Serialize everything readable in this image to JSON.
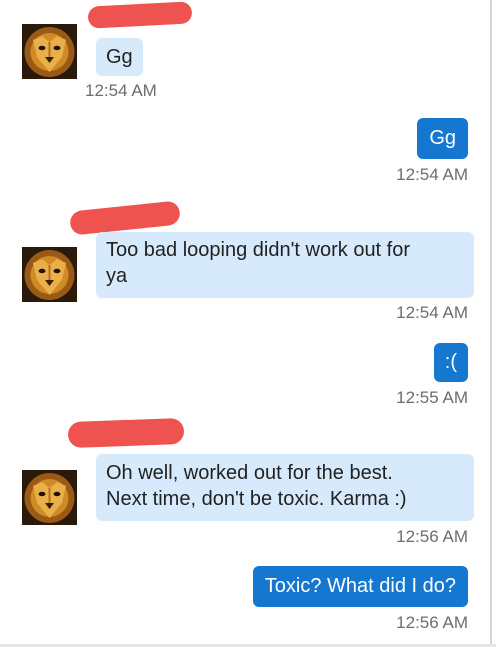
{
  "messages": [
    {
      "id": "m1",
      "direction": "incoming",
      "text": "Gg",
      "time": "12:54 AM",
      "sender_redacted": true
    },
    {
      "id": "m2",
      "direction": "outgoing",
      "text": "Gg",
      "time": "12:54 AM"
    },
    {
      "id": "m3",
      "direction": "incoming",
      "text": "Too bad looping didn't work out for\nya",
      "time": "12:54 AM",
      "sender_redacted": true
    },
    {
      "id": "m4",
      "direction": "outgoing",
      "text": ":(",
      "time": "12:55 AM"
    },
    {
      "id": "m5",
      "direction": "incoming",
      "text": "Oh well, worked out for the best.\nNext time, don't be toxic. Karma :)",
      "time": "12:56 AM",
      "sender_redacted": true
    },
    {
      "id": "m6",
      "direction": "outgoing",
      "text": "Toxic? What did I do?",
      "time": "12:56 AM"
    }
  ],
  "avatar_icon": "lion-face-icon",
  "colors": {
    "incoming_bubble": "#d6eafb",
    "outgoing_bubble": "#1577d0",
    "redaction": "#ef5350",
    "timestamp": "#6d6d6d"
  }
}
